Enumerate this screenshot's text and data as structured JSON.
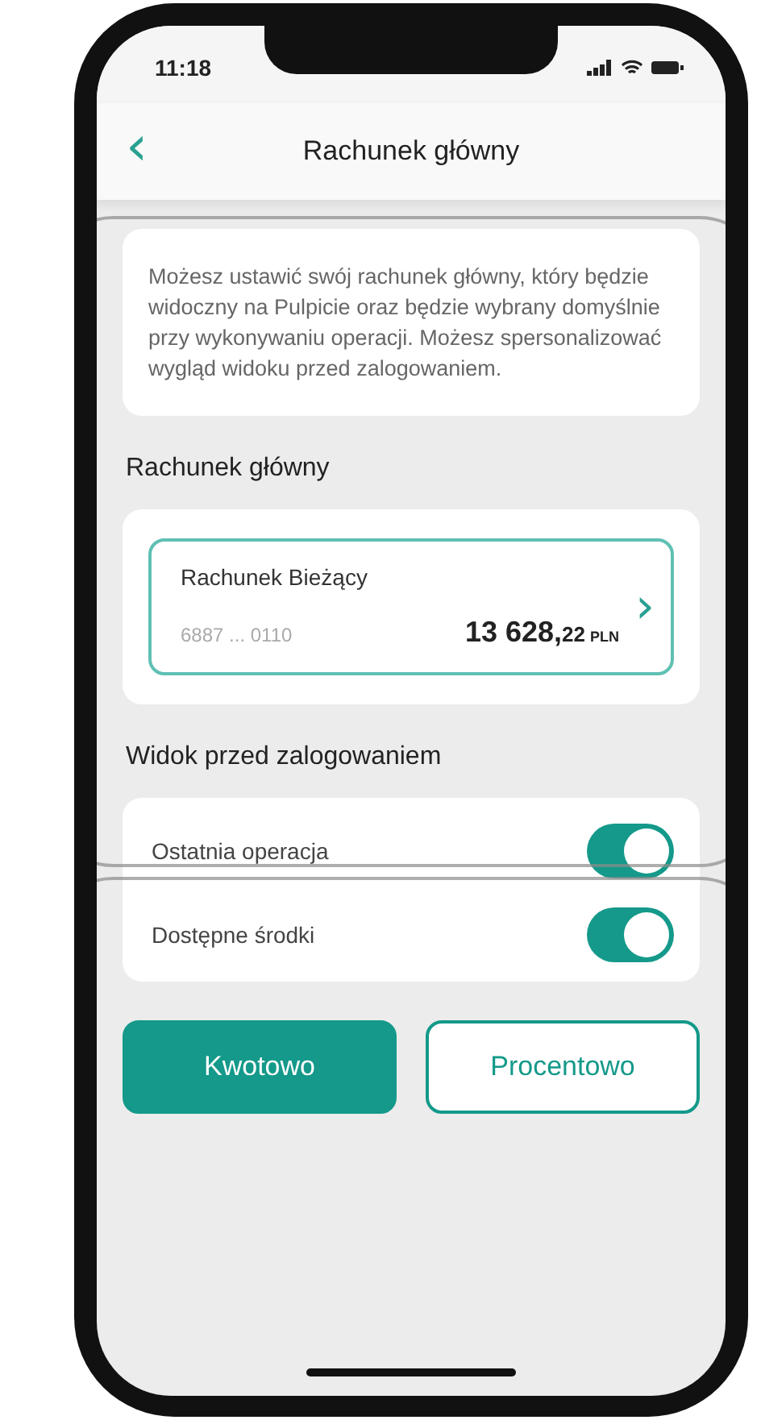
{
  "status_bar": {
    "time": "11:18"
  },
  "header": {
    "back": "‹",
    "title": "Rachunek główny"
  },
  "info": "Możesz ustawić swój rachunek główny, który będzie widoczny na Pulpicie oraz będzie wybrany domyślnie przy wykonywaniu operacji. Możesz spersonalizować wygląd widoku przed zalogowaniem.",
  "main_account_heading": "Rachunek główny",
  "account": {
    "name": "Rachunek Bieżący",
    "number": "6887 ... 0110",
    "amount_whole": "13 628,",
    "amount_fraction": "22",
    "currency": "PLN",
    "chevron": "›"
  },
  "prelogin_heading": "Widok przed zalogowaniem",
  "toggles": [
    {
      "label": "Ostatnia operacja",
      "on": true
    },
    {
      "label": "Dostępne środki",
      "on": true
    }
  ],
  "modes": [
    {
      "label": "Kwotowo",
      "selected": true
    },
    {
      "label": "Procentowo",
      "selected": false
    }
  ]
}
